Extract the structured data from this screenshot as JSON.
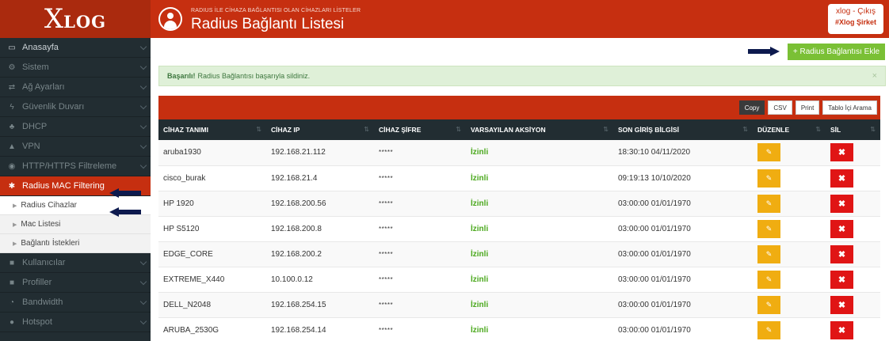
{
  "brand": {
    "logo_big": "X",
    "logo_rest": "LOG"
  },
  "header": {
    "subtitle": "RADIUS İLE CİHAZA BAĞLANTISI OLAN CİHAZLARI LİSTELER",
    "title": "Radius Bağlantı Listesi",
    "user": "xlog",
    "logout": "Çıkış",
    "company": "#Xlog Şirket"
  },
  "sidebar": {
    "items": [
      {
        "label": "Anasayfa",
        "icon": "laptop-icon",
        "glyph": "▭"
      },
      {
        "label": "Sistem",
        "icon": "gears-icon",
        "glyph": "⚙"
      },
      {
        "label": "Ağ Ayarları",
        "icon": "random-icon",
        "glyph": "⇄"
      },
      {
        "label": "Güvenlik Duvarı",
        "icon": "bolt-icon",
        "glyph": "ϟ"
      },
      {
        "label": "DHCP",
        "icon": "sitemap-icon",
        "glyph": "♣"
      },
      {
        "label": "VPN",
        "icon": "vpn-icon",
        "glyph": "▲"
      },
      {
        "label": "HTTP/HTTPS Filtreleme",
        "icon": "eye-slash-icon",
        "glyph": "◉"
      },
      {
        "label": "Radius MAC Filtering",
        "icon": "asterisk-icon",
        "glyph": "✱"
      }
    ],
    "subitems": [
      {
        "label": "Radius Cihazlar"
      },
      {
        "label": "Mac Listesi"
      },
      {
        "label": "Bağlantı İstekleri"
      }
    ],
    "items_after": [
      {
        "label": "Kullanıcılar",
        "icon": "th-large-icon",
        "glyph": "■"
      },
      {
        "label": "Profiller",
        "icon": "th-large-icon",
        "glyph": "■"
      },
      {
        "label": "Bandwidth",
        "icon": "tachometer-icon",
        "glyph": "◔"
      },
      {
        "label": "Hotspot",
        "icon": "globe-icon",
        "glyph": "●"
      }
    ]
  },
  "actions": {
    "add_label": "+ Radius Bağlantısı Ekle"
  },
  "alert": {
    "strong": "Başarılı!",
    "text": "Radius Bağlantısı başarıyla sildiniz.",
    "close": "×"
  },
  "table_tools": {
    "copy": "Copy",
    "csv": "CSV",
    "print": "Print",
    "search": "Tablo İçi Arama"
  },
  "table": {
    "columns": [
      "CİHAZ TANIMI",
      "CİHAZ IP",
      "CİHAZ ŞİFRE",
      "VARSAYILAN AKSİYON",
      "SON GİRİŞ BİLGİSİ",
      "DÜZENLE",
      "SİL"
    ],
    "rows": [
      {
        "name": "aruba1930",
        "ip": "192.168.21.112",
        "password": "*****",
        "action": "İzinli",
        "last_login": "18:30:10 04/11/2020"
      },
      {
        "name": "cisco_burak",
        "ip": "192.168.21.4",
        "password": "*****",
        "action": "İzinli",
        "last_login": "09:19:13 10/10/2020"
      },
      {
        "name": "HP 1920",
        "ip": "192.168.200.56",
        "password": "*****",
        "action": "İzinli",
        "last_login": "03:00:00 01/01/1970"
      },
      {
        "name": "HP S5120",
        "ip": "192.168.200.8",
        "password": "*****",
        "action": "İzinli",
        "last_login": "03:00:00 01/01/1970"
      },
      {
        "name": "EDGE_CORE",
        "ip": "192.168.200.2",
        "password": "*****",
        "action": "İzinli",
        "last_login": "03:00:00 01/01/1970"
      },
      {
        "name": "EXTREME_X440",
        "ip": "10.100.0.12",
        "password": "*****",
        "action": "İzinli",
        "last_login": "03:00:00 01/01/1970"
      },
      {
        "name": "DELL_N2048",
        "ip": "192.168.254.15",
        "password": "*****",
        "action": "İzinli",
        "last_login": "03:00:00 01/01/1970"
      },
      {
        "name": "ARUBA_2530G",
        "ip": "192.168.254.14",
        "password": "*****",
        "action": "İzinli",
        "last_login": "03:00:00 01/01/1970"
      }
    ]
  },
  "colors": {
    "brand": "#c62f10",
    "sidebar": "#222d32",
    "add": "#7ac035",
    "edit": "#f0ad11",
    "delete": "#e01515",
    "allowed": "#4aa81c",
    "arrow": "#0d1a4e"
  }
}
